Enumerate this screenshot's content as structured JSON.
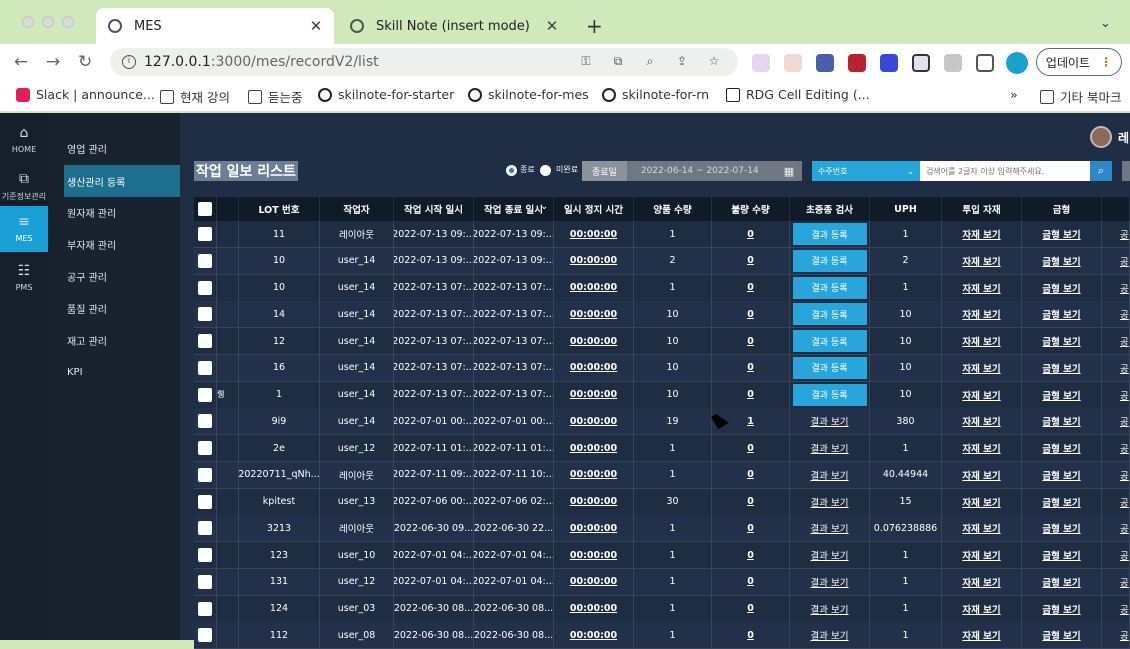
{
  "browser": {
    "tabs": [
      {
        "title": "MES"
      },
      {
        "title": "Skill Note (insert mode)"
      }
    ],
    "url_host": "127.0.0.1",
    "url_rest": ":3000/mes/recordV2/list",
    "update_label": "업데이트",
    "bookmarks": [
      {
        "label": "Slack | announce..."
      },
      {
        "label": "현재 강의"
      },
      {
        "label": "듣는중"
      },
      {
        "label": "skilnote-for-starter"
      },
      {
        "label": "skilnote-for-mes"
      },
      {
        "label": "skilnote-for-rn"
      },
      {
        "label": "RDG Cell Editing (..."
      }
    ],
    "bookmarks_more": "»",
    "other_bookmarks": "기타 북마크"
  },
  "rail": [
    {
      "icon": "⌂",
      "label": "HOME"
    },
    {
      "icon": "⧉",
      "label": "기준정보관리"
    },
    {
      "icon": "≡",
      "label": "MES"
    },
    {
      "icon": "☷",
      "label": "PMS"
    }
  ],
  "sidebar": [
    {
      "label": "영업 관리"
    },
    {
      "label": "생산관리 등록"
    },
    {
      "label": "원자재 관리"
    },
    {
      "label": "부자재 관리"
    },
    {
      "label": "공구 관리"
    },
    {
      "label": "품질 관리"
    },
    {
      "label": "재고 관리"
    },
    {
      "label": "KPI"
    }
  ],
  "page": {
    "title": "작업 일보 리스트",
    "radio_done": "종료",
    "radio_undone": "미완료",
    "date_mode": "종료일",
    "date_range": "2022-06-14 ~ 2022-07-14",
    "order_select": "수주번호",
    "search_placeholder": "검색어를 2글자 이상 입력해주세요.",
    "user_initial": "레"
  },
  "table": {
    "headers": [
      "",
      "",
      "LOT 번호",
      "작업자",
      "작업 시작 일시",
      "작업 종료 일시",
      "일시 정지 시간",
      "양품 수량",
      "불량 수량",
      "초중종 검사",
      "UPH",
      "투입 자재",
      "금형",
      ""
    ],
    "rows": [
      {
        "lot": "11",
        "worker": "레이아웃",
        "start": "2022-07-13 09:...",
        "end": "2022-07-13 09:...",
        "pause": "00:00:00",
        "good": "1",
        "bad": "0",
        "insp": "결과 등록",
        "uph": "1",
        "mat": "자재 보기",
        "mold": "금형 보기",
        "mark": ""
      },
      {
        "lot": "10",
        "worker": "user_14",
        "start": "2022-07-13 09:...",
        "end": "2022-07-13 09:...",
        "pause": "00:00:00",
        "good": "2",
        "bad": "0",
        "insp": "결과 등록",
        "uph": "2",
        "mat": "자재 보기",
        "mold": "금형 보기",
        "mark": ""
      },
      {
        "lot": "10",
        "worker": "user_14",
        "start": "2022-07-13 07:...",
        "end": "2022-07-13 07:...",
        "pause": "00:00:00",
        "good": "1",
        "bad": "0",
        "insp": "결과 등록",
        "uph": "1",
        "mat": "자재 보기",
        "mold": "금형 보기",
        "mark": ""
      },
      {
        "lot": "14",
        "worker": "user_14",
        "start": "2022-07-13 07:...",
        "end": "2022-07-13 07:...",
        "pause": "00:00:00",
        "good": "10",
        "bad": "0",
        "insp": "결과 등록",
        "uph": "10",
        "mat": "자재 보기",
        "mold": "금형 보기",
        "mark": ""
      },
      {
        "lot": "12",
        "worker": "user_14",
        "start": "2022-07-13 07:...",
        "end": "2022-07-13 07:...",
        "pause": "00:00:00",
        "good": "10",
        "bad": "0",
        "insp": "결과 등록",
        "uph": "10",
        "mat": "자재 보기",
        "mold": "금형 보기",
        "mark": ""
      },
      {
        "lot": "16",
        "worker": "user_14",
        "start": "2022-07-13 07:...",
        "end": "2022-07-13 07:...",
        "pause": "00:00:00",
        "good": "10",
        "bad": "0",
        "insp": "결과 등록",
        "uph": "10",
        "mat": "자재 보기",
        "mold": "금형 보기",
        "mark": ""
      },
      {
        "lot": "1",
        "worker": "user_14",
        "start": "2022-07-13 07:...",
        "end": "2022-07-13 07:...",
        "pause": "00:00:00",
        "good": "10",
        "bad": "0",
        "insp": "결과 등록",
        "uph": "10",
        "mat": "자재 보기",
        "mold": "금형 보기",
        "mark": "뤵"
      },
      {
        "lot": "9i9",
        "worker": "user_14",
        "start": "2022-07-01 00:...",
        "end": "2022-07-01 00:...",
        "pause": "00:00:00",
        "good": "19",
        "bad": "1",
        "insp": "결과 보기",
        "uph": "380",
        "mat": "자재 보기",
        "mold": "금형 보기",
        "mark": ""
      },
      {
        "lot": "2e",
        "worker": "user_12",
        "start": "2022-07-11 01:...",
        "end": "2022-07-11 01:...",
        "pause": "00:00:00",
        "good": "1",
        "bad": "0",
        "insp": "결과 보기",
        "uph": "1",
        "mat": "자재 보기",
        "mold": "금형 보기",
        "mark": ""
      },
      {
        "lot": "20220711_qNh...",
        "worker": "레이아웃",
        "start": "2022-07-11 09:...",
        "end": "2022-07-11 10:...",
        "pause": "00:00:00",
        "good": "1",
        "bad": "0",
        "insp": "결과 보기",
        "uph": "40.44944",
        "mat": "자재 보기",
        "mold": "금형 보기",
        "mark": ""
      },
      {
        "lot": "kpitest",
        "worker": "user_13",
        "start": "2022-07-06 00:...",
        "end": "2022-07-06 02:...",
        "pause": "00:00:00",
        "good": "30",
        "bad": "0",
        "insp": "결과 보기",
        "uph": "15",
        "mat": "자재 보기",
        "mold": "금형 보기",
        "mark": ""
      },
      {
        "lot": "3213",
        "worker": "레이아웃",
        "start": "2022-06-30 09...",
        "end": "2022-06-30 22...",
        "pause": "00:00:00",
        "good": "1",
        "bad": "0",
        "insp": "결과 보기",
        "uph": "0.076238886",
        "mat": "자재 보기",
        "mold": "금형 보기",
        "mark": ""
      },
      {
        "lot": "123",
        "worker": "user_10",
        "start": "2022-07-01 04:...",
        "end": "2022-07-01 04:...",
        "pause": "00:00:00",
        "good": "1",
        "bad": "0",
        "insp": "결과 보기",
        "uph": "1",
        "mat": "자재 보기",
        "mold": "금형 보기",
        "mark": ""
      },
      {
        "lot": "131",
        "worker": "user_12",
        "start": "2022-07-01 04:...",
        "end": "2022-07-01 04:...",
        "pause": "00:00:00",
        "good": "1",
        "bad": "0",
        "insp": "결과 보기",
        "uph": "1",
        "mat": "자재 보기",
        "mold": "금형 보기",
        "mark": ""
      },
      {
        "lot": "124",
        "worker": "user_03",
        "start": "2022-06-30 08...",
        "end": "2022-06-30 08...",
        "pause": "00:00:00",
        "good": "1",
        "bad": "0",
        "insp": "결과 보기",
        "uph": "1",
        "mat": "자재 보기",
        "mold": "금형 보기",
        "mark": ""
      },
      {
        "lot": "112",
        "worker": "user_08",
        "start": "2022-06-30 08...",
        "end": "2022-06-30 08...",
        "pause": "00:00:00",
        "good": "1",
        "bad": "0",
        "insp": "결과 보기",
        "uph": "1",
        "mat": "자재 보기",
        "mold": "금형 보기",
        "mark": ""
      }
    ],
    "cut_label": "공"
  }
}
